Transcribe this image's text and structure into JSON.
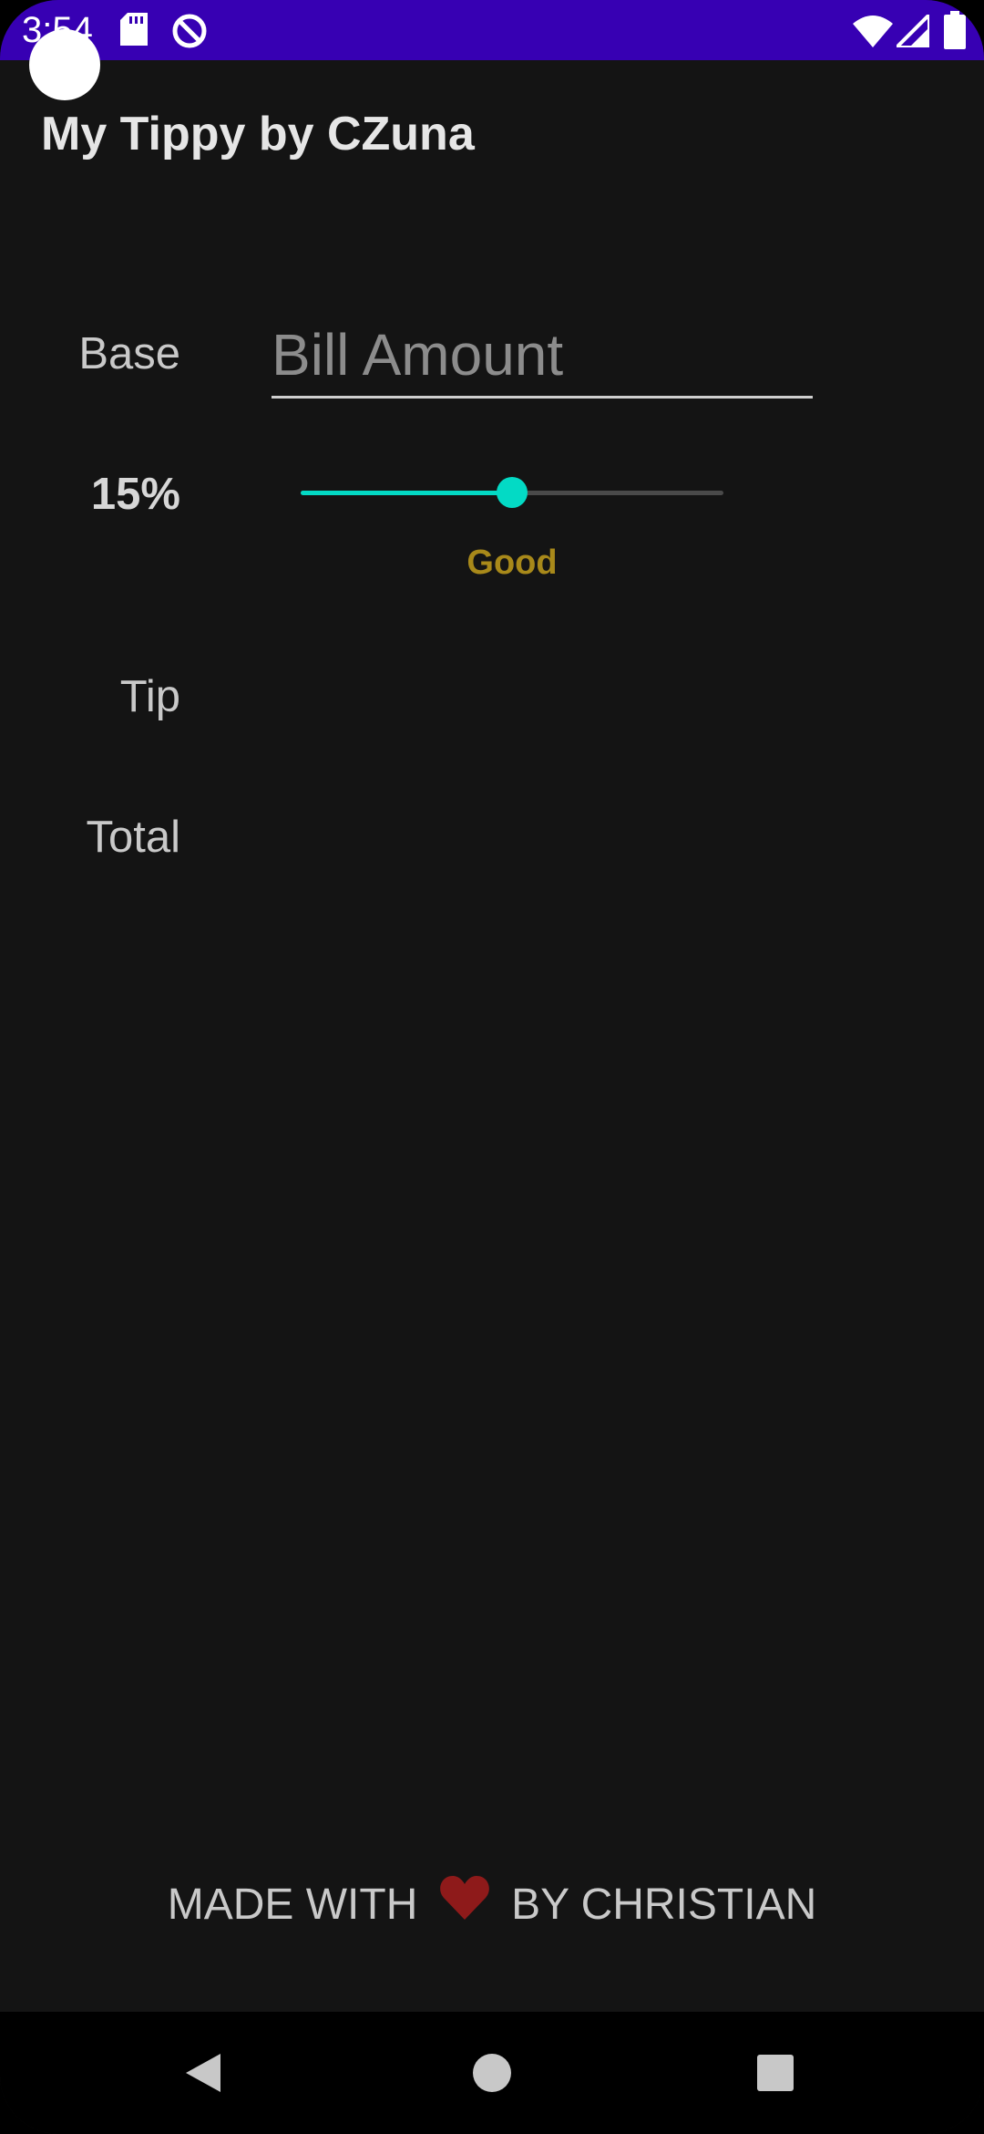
{
  "status_bar": {
    "time": "3:54",
    "icons": [
      "sd-card-icon",
      "no-disturb-icon",
      "wifi-icon",
      "signal-icon",
      "battery-icon"
    ],
    "color": "#3700B3"
  },
  "app": {
    "title": "My Tippy by CZuna"
  },
  "form": {
    "base_label": "Base",
    "bill_placeholder": "Bill Amount",
    "bill_value": "",
    "percent_label": "15%",
    "tip_percent": 15,
    "tip_percent_max": 30,
    "tip_description": "Good",
    "tip_label": "Tip",
    "total_label": "Total"
  },
  "footer": {
    "text_before": "MADE WITH",
    "heart_icon": "heart-icon",
    "text_after": "BY CHRISTIAN"
  },
  "nav_bar": {
    "icons": [
      "back-icon",
      "home-icon",
      "recents-icon"
    ]
  },
  "colors": {
    "accent": "#03DAC5",
    "status": "#3700B3",
    "description": "#a8891a",
    "background": "#141414"
  }
}
